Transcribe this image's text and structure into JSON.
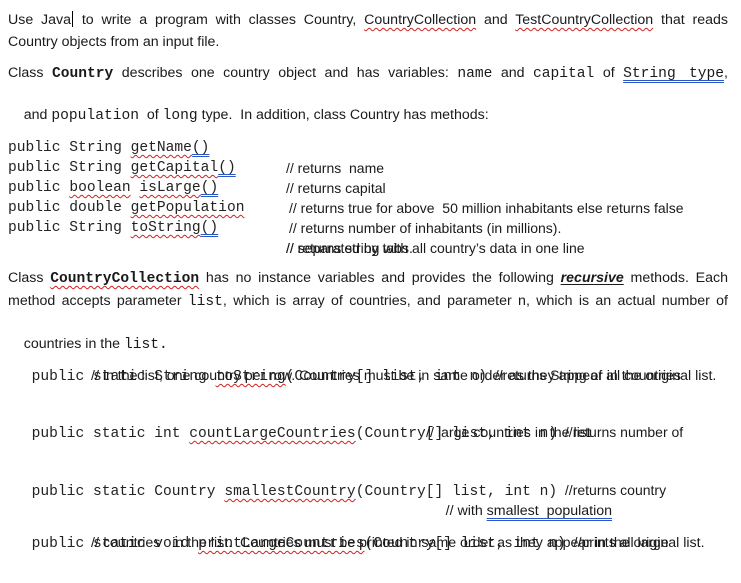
{
  "intro": {
    "line1_a": "Use Java",
    "line1_b": " to write a program with classes Country, ",
    "class2": "CountryCollection",
    "and": " and ",
    "class3": "TestCountryCollection",
    "line1_end": " that reads",
    "line2": "Country objects from an input file."
  },
  "country_desc": {
    "pre": "Class ",
    "class_name": "Country",
    "mid1": " describes one country object and has variables: ",
    "var1": "name",
    "and": "  and  ",
    "var2": "capital",
    "of": "  of  ",
    "type1": "String type",
    "comma": ",",
    "line2_pre": "and ",
    "var3": "population",
    "line2_of": "  of ",
    "type2": "long",
    "line2_end": " type.  In addition, class Country has methods:"
  },
  "country_methods": [
    {
      "prefix": "public String ",
      "name": "getName",
      "suffix": "()",
      "comment": "// returns  name"
    },
    {
      "prefix": "public String ",
      "name": "getCapital",
      "suffix": "()",
      "comment": "// returns capital"
    },
    {
      "prefix": "public ",
      "type": "boolean",
      "mid": " ",
      "name": "isLarge",
      "suffix": "()",
      "comment": "// returns true for above  50 million inhabitants else returns false"
    },
    {
      "prefix": "public double ",
      "name": "getPopulation",
      "suffix": "",
      "comment": "// returns number of inhabitants (in millions)."
    },
    {
      "prefix": "public String ",
      "name": "toString",
      "suffix": "()",
      "comment": "// returns string with all country’s data in one line"
    }
  ],
  "country_methods_extra_comment": "// separated by tabs.",
  "collection_desc": {
    "pre": "Class ",
    "class_name": "CountryCollection",
    "mid1": " has no instance variables and provides the following ",
    "emph": "recursive",
    "mid2": " methods. Each",
    "line2_a": "method accepts parameter ",
    "param1": "list",
    "line2_b": ",  which is array of countries, and parameter n,  which is an actual number of",
    "line3_a": "countries in the ",
    "param2": "list",
    "line3_b": "."
  },
  "collection_methods": [
    {
      "prefix": "public static String ",
      "name": "toString",
      "params": "(Country[] list, int n)",
      "comment": "  //returns String of all countries",
      "comment2": "// in the list, one country per row. Countries must be in same order as they appear in the original list."
    },
    {
      "prefix": "public static int ",
      "name": "countLargeCountries",
      "params": "(Country[] list, int n)",
      "comment": "  //returns number of",
      "comment2": "// large countries in the list"
    },
    {
      "prefix": "public static Country ",
      "name": "smallestCountry",
      "params": "(Country[] list, int n)",
      "comment": "  //returns country",
      "comment2_pre": "// with ",
      "comment2_link": "smallest  population"
    },
    {
      "prefix": "public static void ",
      "name": "printLargeCountries",
      "params": "(Country[] list, int n)",
      "comment": "  //prints all large",
      "comment2": "// countries   in the list.  Countries must be printed in same order as they appear in the original list."
    }
  ]
}
